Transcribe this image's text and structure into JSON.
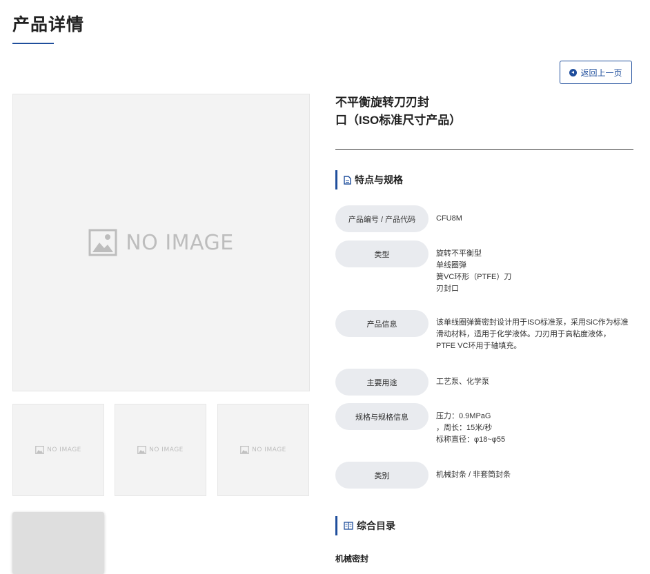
{
  "page": {
    "title": "产品详情"
  },
  "back_button": {
    "label": "返回上一页"
  },
  "images": {
    "placeholder_main": "NO IMAGE",
    "placeholder_thumb": "NO IMAGE"
  },
  "product": {
    "title_line1": "不平衡旋转刀刃封",
    "title_line2": "口（ISO标准尺寸产品）"
  },
  "sections": {
    "features": "特点与规格",
    "catalog": "综合目录"
  },
  "specs": [
    {
      "label": "产品编号 / 产品代码",
      "lines": [
        "CFU8M"
      ]
    },
    {
      "label": "类型",
      "lines": [
        "旋转不平衡型",
        "单线圈弹",
        "簧VC环形（PTFE）刀",
        "刃封口"
      ]
    },
    {
      "label": "产品信息",
      "lines": [
        "该单线圈弹簧密封设计用于ISO标准泵，采用SiC作为标准",
        "滑动材料，适用于化学液体。刀刃用于高粘度液体，",
        "PTFE VC环用于轴填充。"
      ]
    },
    {
      "label": "主要用途",
      "lines": [
        "工艺泵、化学泵"
      ]
    },
    {
      "label": "规格与规格信息",
      "lines": [
        "压力：0.9MPaG",
        "，周长：15米/秒",
        "标称直径：φ18~φ55"
      ]
    },
    {
      "label": "类别",
      "lines": [
        "机械封条 / 非套筒封条"
      ]
    }
  ],
  "catalog": {
    "first_item": "机械密封"
  },
  "colors": {
    "accent": "#1f4e9c",
    "placeholder_bg": "#f3f3f3",
    "label_pill_bg": "#e9ebef"
  }
}
